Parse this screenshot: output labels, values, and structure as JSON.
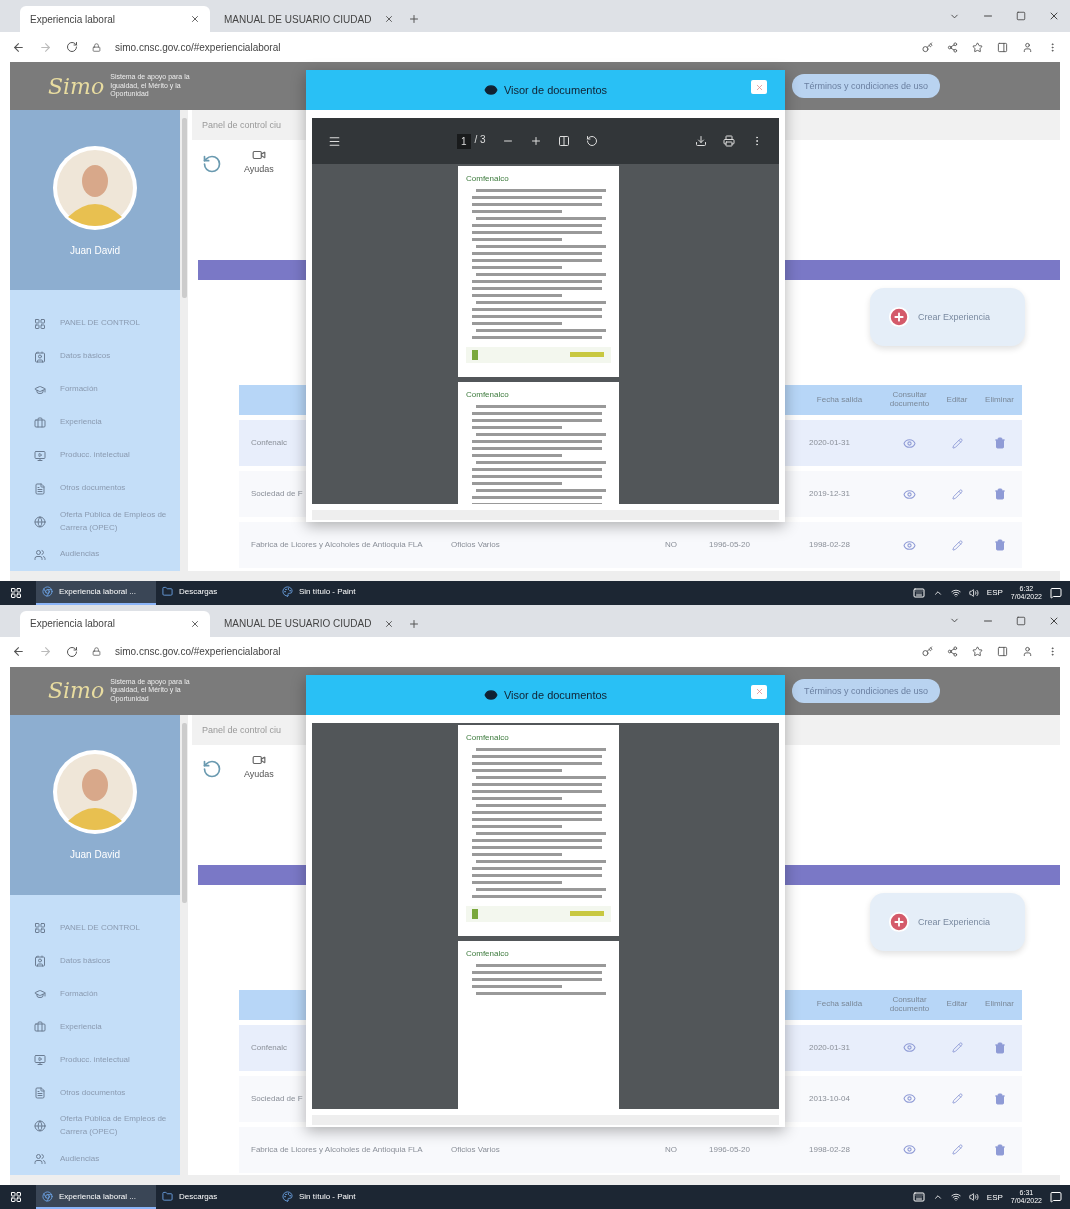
{
  "screens": [
    {
      "browser": {
        "tabs": [
          {
            "title": "Experiencia laboral",
            "selected": true
          },
          {
            "title": "MANUAL DE USUARIO CIUDAD",
            "selected": false
          }
        ],
        "url": "simo.cnsc.gov.co/#experiencialaboral"
      },
      "app": {
        "logo": "Simo",
        "tagline": "Sistema de apoyo para la Igualdad, el Mérito y la Oportunidad",
        "terms": "Términos y condiciones de uso",
        "user": "Juan David",
        "breadcrumb": "Panel de control ciu",
        "help": "Ayudas",
        "create": "Crear Experiencia",
        "menu": [
          {
            "kind": "grid",
            "label": "PANEL DE CONTROL"
          },
          {
            "kind": "contact",
            "label": "Datos básicos"
          },
          {
            "kind": "education",
            "label": "Formación"
          },
          {
            "kind": "work",
            "label": "Experiencia"
          },
          {
            "kind": "media",
            "label": "Producc. intelectual"
          },
          {
            "kind": "file",
            "label": "Otros documentos"
          },
          {
            "kind": "globe",
            "label": "Oferta Pública de Empleos de Carrera (OPEC)"
          },
          {
            "kind": "people",
            "label": "Audiencias"
          }
        ],
        "columns": [
          "Fecha salida",
          "Consultar documento",
          "Editar",
          "Eliminar"
        ],
        "rows": [
          {
            "company": "Confenalc",
            "end": "2020-01-31",
            "selected": true
          },
          {
            "company": "Sociedad de F",
            "end": "2019-12-31",
            "selected": false
          },
          {
            "company": "Fabrica de Licores y Alcoholes de Antioquia FLA",
            "position": "Oficios Varios",
            "current": "NO",
            "start": "1996-05-20",
            "end": "1998-02-28",
            "selected": false
          }
        ]
      },
      "viewer": {
        "title": "Visor de documentos",
        "toolbar": {
          "page": "1",
          "total": "/ 3"
        },
        "pages": [
          {
            "heading": "Comfenalco",
            "kind": "long",
            "footer": true
          },
          {
            "heading": "Comfenalco",
            "kind": "long",
            "footer": false
          }
        ]
      },
      "taskbar": {
        "apps": [
          {
            "kind": "chrome",
            "label": "Experiencia laboral ...",
            "selected": true
          },
          {
            "kind": "folder",
            "label": "Descargas",
            "selected": false
          },
          {
            "kind": "paint",
            "label": "Sin título - Paint",
            "selected": false
          }
        ],
        "lang": "ESP",
        "time": "6:32",
        "date": "7/04/2022"
      }
    },
    {
      "browser": {
        "tabs": [
          {
            "title": "Experiencia laboral",
            "selected": true
          },
          {
            "title": "MANUAL DE USUARIO CIUDAD",
            "selected": false
          }
        ],
        "url": "simo.cnsc.gov.co/#experiencialaboral"
      },
      "app": {
        "logo": "Simo",
        "tagline": "Sistema de apoyo para la Igualdad, el Mérito y la Oportunidad",
        "terms": "Términos y condiciones de uso",
        "user": "Juan David",
        "breadcrumb": "Panel de control ciu",
        "help": "Ayudas",
        "create": "Crear Experiencia",
        "menu": [
          {
            "kind": "grid",
            "label": "PANEL DE CONTROL"
          },
          {
            "kind": "contact",
            "label": "Datos básicos"
          },
          {
            "kind": "education",
            "label": "Formación"
          },
          {
            "kind": "work",
            "label": "Experiencia"
          },
          {
            "kind": "media",
            "label": "Producc. intelectual"
          },
          {
            "kind": "file",
            "label": "Otros documentos"
          },
          {
            "kind": "globe",
            "label": "Oferta Pública de Empleos de Carrera (OPEC)"
          },
          {
            "kind": "people",
            "label": "Audiencias"
          }
        ],
        "columns": [
          "Fecha salida",
          "Consultar documento",
          "Editar",
          "Eliminar"
        ],
        "rows": [
          {
            "company": "Confenalc",
            "end": "2020-01-31",
            "selected": true
          },
          {
            "company": "Sociedad de F",
            "end": "2013-10-04",
            "selected": false
          },
          {
            "company": "Fabrica de Licores y Alcoholes de Antioquia FLA",
            "position": "Oficios Varios",
            "current": "NO",
            "start": "1996-05-20",
            "end": "1998-02-28",
            "selected": false
          }
        ]
      },
      "viewer": {
        "title": "Visor de documentos",
        "pages": [
          {
            "heading": "Comfenalco",
            "kind": "long",
            "footer": true
          },
          {
            "heading": "Comfenalco",
            "kind": "short",
            "footer": false
          }
        ]
      },
      "taskbar": {
        "apps": [
          {
            "kind": "chrome",
            "label": "Experiencia laboral ...",
            "selected": true
          },
          {
            "kind": "folder",
            "label": "Descargas",
            "selected": false
          },
          {
            "kind": "paint",
            "label": "Sin título - Paint",
            "selected": false
          }
        ],
        "lang": "ESP",
        "time": "6:31",
        "date": "7/04/2022"
      }
    }
  ]
}
